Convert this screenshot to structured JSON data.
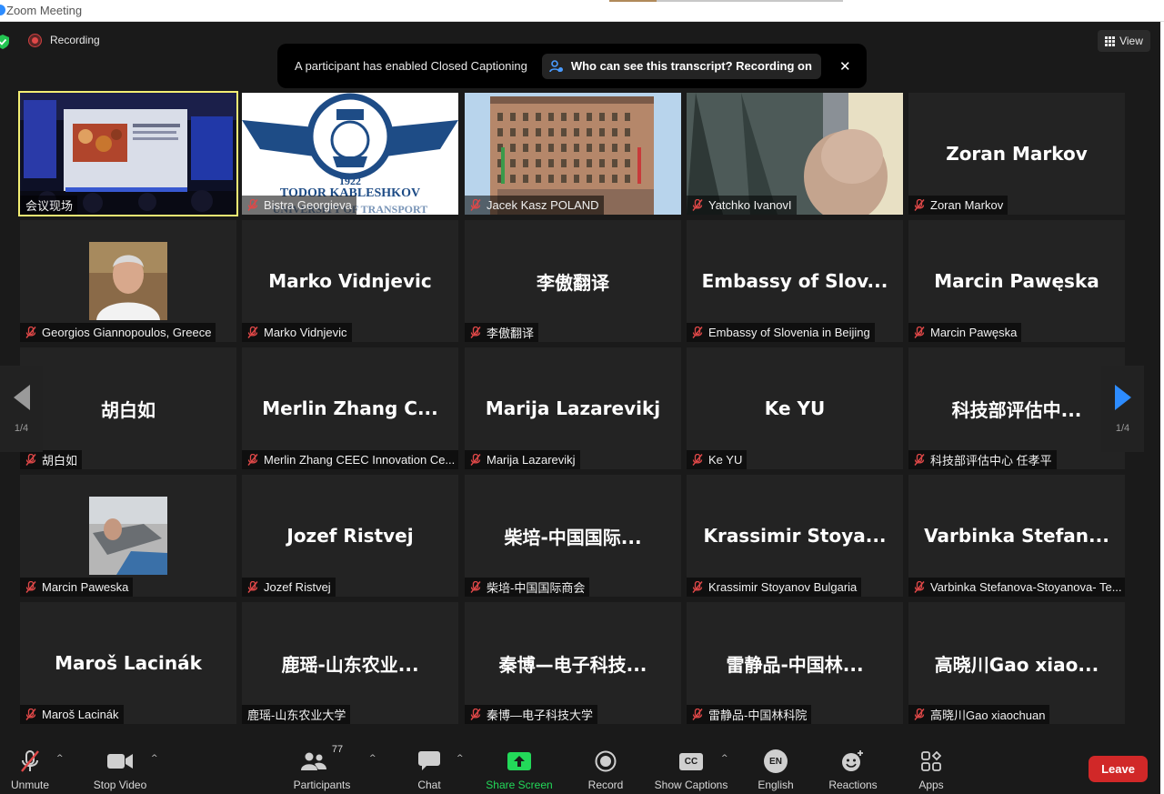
{
  "window": {
    "title": "Zoom Meeting"
  },
  "status": {
    "recording_label": "Recording"
  },
  "view_button": {
    "label": "View"
  },
  "notice": {
    "message": "A participant has enabled Closed Captioning",
    "who_label": "Who can see this transcript? Recording on"
  },
  "pagination": {
    "left_page": "1/4",
    "right_page": "1/4"
  },
  "tiles": [
    {
      "name": "会议现场",
      "display": "",
      "kind": "conference-video",
      "muted": false
    },
    {
      "name": "Bistra Georgieva",
      "display": "",
      "kind": "logo-video",
      "muted": true,
      "logo_year": "1922",
      "logo_text": "TODOR KABLESHKOV",
      "logo_text2": "UNIVERSITY OF TRANSPORT"
    },
    {
      "name": "Jacek Kasz POLAND",
      "display": "",
      "kind": "building-video",
      "muted": true
    },
    {
      "name": "Yatchko IvanovI",
      "display": "",
      "kind": "person-video",
      "muted": true
    },
    {
      "name": "Zoran Markov",
      "display": "Zoran Markov",
      "kind": "name",
      "muted": true
    },
    {
      "name": "Georgios Giannopoulos, Greece",
      "display": "",
      "kind": "avatar-man",
      "muted": true
    },
    {
      "name": "Marko Vidnjevic",
      "display": "Marko Vidnjevic",
      "kind": "name",
      "muted": true
    },
    {
      "name": "李傲翻译",
      "display": "李傲翻译",
      "kind": "name",
      "muted": true
    },
    {
      "name": "Embassy of Slovenia in Beijing",
      "display": "Embassy  of  Slov...",
      "kind": "name",
      "muted": true
    },
    {
      "name": "Marcin Pawęska",
      "display": "Marcin Pawęska",
      "kind": "name",
      "muted": true
    },
    {
      "name": "胡白如",
      "display": "胡白如",
      "kind": "name",
      "muted": true
    },
    {
      "name": "Merlin Zhang CEEC Innovation Ce...",
      "display": "Merlin  Zhang  C...",
      "kind": "name",
      "muted": true
    },
    {
      "name": "Marija Lazarevikj",
      "display": "Marija Lazarevikj",
      "kind": "name",
      "muted": true
    },
    {
      "name": "Ke YU",
      "display": "Ke YU",
      "kind": "name",
      "muted": true
    },
    {
      "name": "科技部评估中心 任孝平",
      "display": "科技部评估中...",
      "kind": "name",
      "muted": true
    },
    {
      "name": "Marcin Paweska",
      "display": "",
      "kind": "avatar-photo",
      "muted": true
    },
    {
      "name": "Jozef Ristvej",
      "display": "Jozef Ristvej",
      "kind": "name",
      "muted": true
    },
    {
      "name": "柴培-中国国际商会",
      "display": "柴培-中国国际...",
      "kind": "name",
      "muted": true
    },
    {
      "name": "Krassimir Stoyanov Bulgaria",
      "display": "Krassimir  Stoya...",
      "kind": "name",
      "muted": true
    },
    {
      "name": "Varbinka Stefanova-Stoyanova- Te...",
      "display": "Varbinka  Stefan...",
      "kind": "name",
      "muted": true
    },
    {
      "name": "Maroš Lacinák",
      "display": "Maroš Lacinák",
      "kind": "name",
      "muted": true
    },
    {
      "name": "鹿瑶-山东农业大学",
      "display": "鹿瑶-山东农业...",
      "kind": "name",
      "muted": false
    },
    {
      "name": "秦博—电子科技大学",
      "display": "秦博—电子科技...",
      "kind": "name",
      "muted": true
    },
    {
      "name": "雷静品-中国林科院",
      "display": "雷静品-中国林...",
      "kind": "name",
      "muted": true
    },
    {
      "name": "高晓川Gao xiaochuan",
      "display": "高晓川Gao  xiao...",
      "kind": "name",
      "muted": true
    }
  ],
  "toolbar": {
    "unmute": "Unmute",
    "stop_video": "Stop Video",
    "participants": "Participants",
    "participants_count": "77",
    "chat": "Chat",
    "share_screen": "Share Screen",
    "record": "Record",
    "show_captions": "Show Captions",
    "cc_glyph": "CC",
    "english": "English",
    "en_glyph": "EN",
    "reactions": "Reactions",
    "apps": "Apps",
    "leave": "Leave"
  },
  "colors": {
    "active_border": "#f3ee73",
    "share_green": "#23d959",
    "leave_red": "#d12828",
    "mute_red": "#e04848"
  }
}
